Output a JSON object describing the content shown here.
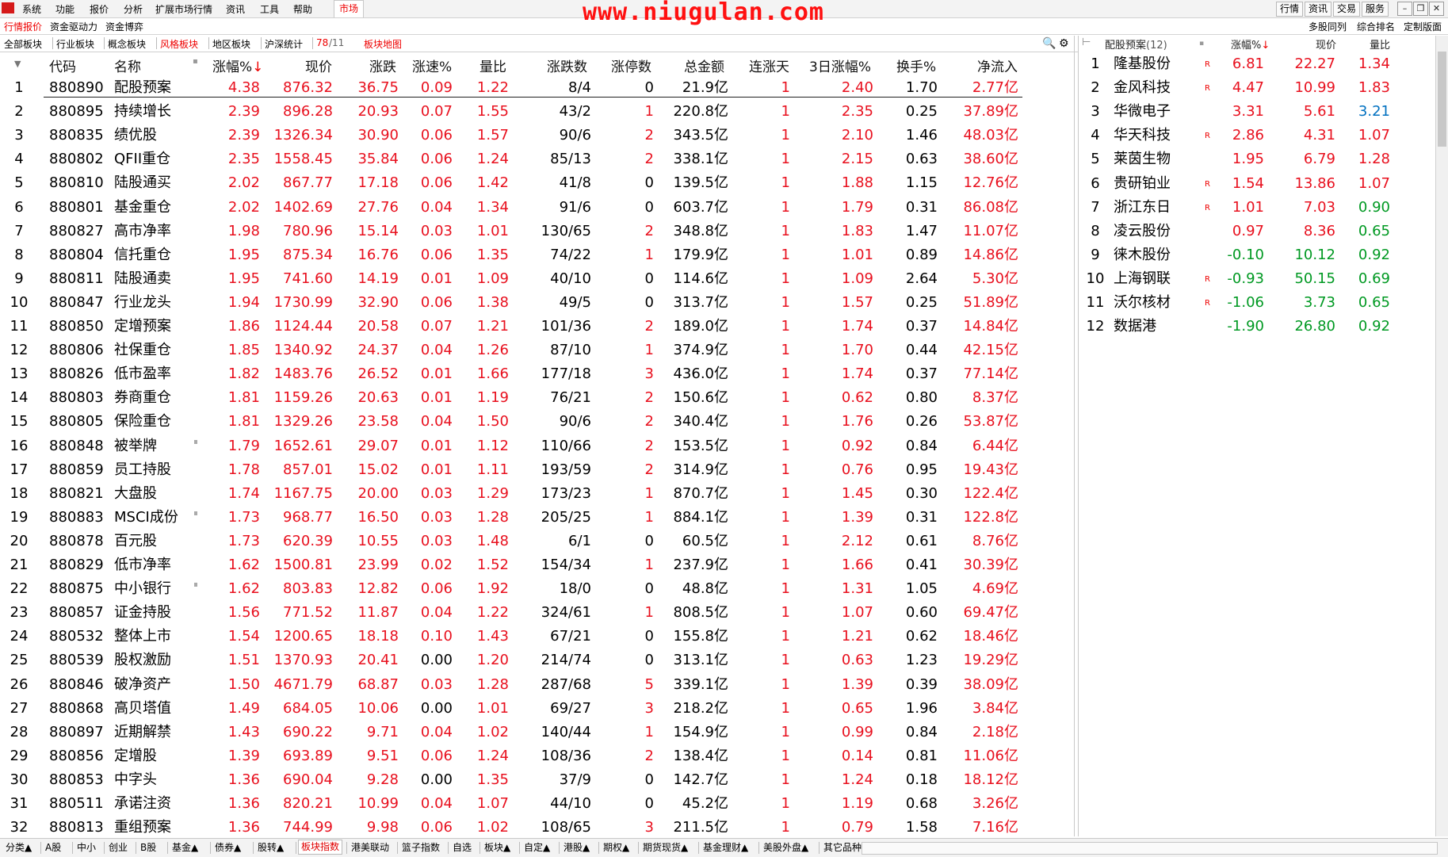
{
  "menubar": {
    "items": [
      "系统",
      "功能",
      "报价",
      "分析",
      "扩展市场行情",
      "资讯",
      "工具",
      "帮助"
    ],
    "market_label": "市场",
    "watermark": "www.niugulan.com",
    "top_right_buttons": [
      "行情",
      "资讯",
      "交易",
      "服务"
    ]
  },
  "row2": {
    "tabs": [
      "行情报价",
      "资金驱动力",
      "资金博弈"
    ],
    "right_tabs": [
      "多股同列",
      "综合排名",
      "定制版面"
    ]
  },
  "row3": {
    "tabs": [
      "全部板块",
      "行业板块",
      "概念板块",
      "风格板块",
      "地区板块",
      "沪深统计"
    ],
    "active_tab": "风格板块",
    "page_current": "78",
    "page_total": "/11",
    "map_label": "板块地图"
  },
  "main_table": {
    "headers": [
      "代码",
      "名称",
      "涨幅%",
      "现价",
      "涨跌",
      "涨速%",
      "量比",
      "涨跌数",
      "涨停数",
      "总金额",
      "连涨天",
      "3日涨幅%",
      "换手%",
      "净流入"
    ],
    "sort_arrow": "↓",
    "rows": [
      [
        "1",
        "880890",
        "配股预案",
        "4.38",
        "876.32",
        "36.75",
        "0.09",
        "1.22",
        "8/4",
        "0",
        "21.9亿",
        "1",
        "2.40",
        "1.70",
        "2.77亿"
      ],
      [
        "2",
        "880895",
        "持续增长",
        "2.39",
        "896.28",
        "20.93",
        "0.07",
        "1.55",
        "43/2",
        "1",
        "220.8亿",
        "1",
        "2.35",
        "0.25",
        "37.89亿"
      ],
      [
        "3",
        "880835",
        "绩优股",
        "2.39",
        "1326.34",
        "30.90",
        "0.06",
        "1.57",
        "90/6",
        "2",
        "343.5亿",
        "1",
        "2.10",
        "1.46",
        "48.03亿"
      ],
      [
        "4",
        "880802",
        "QFII重仓",
        "2.35",
        "1558.45",
        "35.84",
        "0.06",
        "1.24",
        "85/13",
        "2",
        "338.1亿",
        "1",
        "2.15",
        "0.63",
        "38.60亿"
      ],
      [
        "5",
        "880810",
        "陆股通买",
        "2.02",
        "867.77",
        "17.18",
        "0.06",
        "1.42",
        "41/8",
        "0",
        "139.5亿",
        "1",
        "1.88",
        "1.15",
        "12.76亿"
      ],
      [
        "6",
        "880801",
        "基金重仓",
        "2.02",
        "1402.69",
        "27.76",
        "0.04",
        "1.34",
        "91/6",
        "0",
        "603.7亿",
        "1",
        "1.79",
        "0.31",
        "86.08亿"
      ],
      [
        "7",
        "880827",
        "高市净率",
        "1.98",
        "780.96",
        "15.14",
        "0.03",
        "1.01",
        "130/65",
        "2",
        "348.8亿",
        "1",
        "1.83",
        "1.47",
        "11.07亿"
      ],
      [
        "8",
        "880804",
        "信托重仓",
        "1.95",
        "875.34",
        "16.76",
        "0.06",
        "1.35",
        "74/22",
        "1",
        "179.9亿",
        "1",
        "1.01",
        "0.89",
        "14.86亿"
      ],
      [
        "9",
        "880811",
        "陆股通卖",
        "1.95",
        "741.60",
        "14.19",
        "0.01",
        "1.09",
        "40/10",
        "0",
        "114.6亿",
        "1",
        "1.09",
        "2.64",
        "5.30亿"
      ],
      [
        "10",
        "880847",
        "行业龙头",
        "1.94",
        "1730.99",
        "32.90",
        "0.06",
        "1.38",
        "49/5",
        "0",
        "313.7亿",
        "1",
        "1.57",
        "0.25",
        "51.89亿"
      ],
      [
        "11",
        "880850",
        "定增预案",
        "1.86",
        "1124.44",
        "20.58",
        "0.07",
        "1.21",
        "101/36",
        "2",
        "189.0亿",
        "1",
        "1.74",
        "0.37",
        "14.84亿"
      ],
      [
        "12",
        "880806",
        "社保重仓",
        "1.85",
        "1340.92",
        "24.37",
        "0.04",
        "1.26",
        "87/10",
        "1",
        "374.9亿",
        "1",
        "1.70",
        "0.44",
        "42.15亿"
      ],
      [
        "13",
        "880826",
        "低市盈率",
        "1.82",
        "1483.76",
        "26.52",
        "0.01",
        "1.66",
        "177/18",
        "3",
        "436.0亿",
        "1",
        "1.74",
        "0.37",
        "77.14亿"
      ],
      [
        "14",
        "880803",
        "券商重仓",
        "1.81",
        "1159.26",
        "20.63",
        "0.01",
        "1.19",
        "76/21",
        "2",
        "150.6亿",
        "1",
        "0.62",
        "0.80",
        "8.37亿"
      ],
      [
        "15",
        "880805",
        "保险重仓",
        "1.81",
        "1329.26",
        "23.58",
        "0.04",
        "1.50",
        "90/6",
        "2",
        "340.4亿",
        "1",
        "1.76",
        "0.26",
        "53.87亿"
      ],
      [
        "16",
        "880848",
        "被举牌",
        "1.79",
        "1652.61",
        "29.07",
        "0.01",
        "1.12",
        "110/66",
        "2",
        "153.5亿",
        "1",
        "0.92",
        "0.84",
        "6.44亿"
      ],
      [
        "17",
        "880859",
        "员工持股",
        "1.78",
        "857.01",
        "15.02",
        "0.01",
        "1.11",
        "193/59",
        "2",
        "314.9亿",
        "1",
        "0.76",
        "0.95",
        "19.43亿"
      ],
      [
        "18",
        "880821",
        "大盘股",
        "1.74",
        "1167.75",
        "20.00",
        "0.03",
        "1.29",
        "173/23",
        "1",
        "870.7亿",
        "1",
        "1.45",
        "0.30",
        "122.4亿"
      ],
      [
        "19",
        "880883",
        "MSCI成份",
        "1.73",
        "968.77",
        "16.50",
        "0.03",
        "1.28",
        "205/25",
        "1",
        "884.1亿",
        "1",
        "1.39",
        "0.31",
        "122.8亿"
      ],
      [
        "20",
        "880878",
        "百元股",
        "1.73",
        "620.39",
        "10.55",
        "0.03",
        "1.48",
        "6/1",
        "0",
        "60.5亿",
        "1",
        "2.12",
        "0.61",
        "8.76亿"
      ],
      [
        "21",
        "880829",
        "低市净率",
        "1.62",
        "1500.81",
        "23.99",
        "0.02",
        "1.52",
        "154/34",
        "1",
        "237.9亿",
        "1",
        "1.66",
        "0.41",
        "30.39亿"
      ],
      [
        "22",
        "880875",
        "中小银行",
        "1.62",
        "803.83",
        "12.82",
        "0.06",
        "1.92",
        "18/0",
        "0",
        "48.8亿",
        "1",
        "1.31",
        "1.05",
        "4.69亿"
      ],
      [
        "23",
        "880857",
        "证金持股",
        "1.56",
        "771.52",
        "11.87",
        "0.04",
        "1.22",
        "324/61",
        "1",
        "808.5亿",
        "1",
        "1.07",
        "0.60",
        "69.47亿"
      ],
      [
        "24",
        "880532",
        "整体上市",
        "1.54",
        "1200.65",
        "18.18",
        "0.10",
        "1.43",
        "67/21",
        "0",
        "155.8亿",
        "1",
        "1.21",
        "0.62",
        "18.46亿"
      ],
      [
        "25",
        "880539",
        "股权激励",
        "1.51",
        "1370.93",
        "20.41",
        "0.00",
        "1.20",
        "214/74",
        "0",
        "313.1亿",
        "1",
        "0.63",
        "1.23",
        "19.29亿"
      ],
      [
        "26",
        "880846",
        "破净资产",
        "1.50",
        "4671.79",
        "68.87",
        "0.03",
        "1.28",
        "287/68",
        "5",
        "339.1亿",
        "1",
        "1.39",
        "0.39",
        "38.09亿"
      ],
      [
        "27",
        "880868",
        "高贝塔值",
        "1.49",
        "684.05",
        "10.06",
        "0.00",
        "1.01",
        "69/27",
        "3",
        "218.2亿",
        "1",
        "0.65",
        "1.96",
        "3.84亿"
      ],
      [
        "28",
        "880897",
        "近期解禁",
        "1.43",
        "690.22",
        "9.71",
        "0.04",
        "1.02",
        "140/44",
        "1",
        "154.9亿",
        "1",
        "0.99",
        "0.84",
        "2.18亿"
      ],
      [
        "29",
        "880856",
        "定增股",
        "1.39",
        "693.89",
        "9.51",
        "0.06",
        "1.24",
        "108/36",
        "2",
        "138.4亿",
        "1",
        "0.14",
        "0.81",
        "11.06亿"
      ],
      [
        "30",
        "880853",
        "中字头",
        "1.36",
        "690.04",
        "9.28",
        "0.00",
        "1.35",
        "37/9",
        "0",
        "142.7亿",
        "1",
        "1.24",
        "0.18",
        "18.12亿"
      ],
      [
        "31",
        "880511",
        "承诺注资",
        "1.36",
        "820.21",
        "10.99",
        "0.04",
        "1.07",
        "44/10",
        "0",
        "45.2亿",
        "1",
        "1.19",
        "0.68",
        "3.26亿"
      ],
      [
        "32",
        "880813",
        "重组预案",
        "1.36",
        "744.99",
        "9.98",
        "0.06",
        "1.02",
        "108/65",
        "3",
        "211.5亿",
        "1",
        "0.79",
        "1.58",
        "7.16亿"
      ]
    ]
  },
  "right_panel": {
    "title": "配股预案",
    "count": "(12)",
    "headers": [
      "涨幅%",
      "现价",
      "量比"
    ],
    "sort_arrow": "↓",
    "rows": [
      [
        "1",
        "隆基股份",
        "R",
        "6.81",
        "22.27",
        "1.34"
      ],
      [
        "2",
        "金风科技",
        "R",
        "4.47",
        "10.99",
        "1.83"
      ],
      [
        "3",
        "华微电子",
        "",
        "3.31",
        "5.61",
        "3.21"
      ],
      [
        "4",
        "华天科技",
        "R",
        "2.86",
        "4.31",
        "1.07"
      ],
      [
        "5",
        "莱茵生物",
        "",
        "1.95",
        "6.79",
        "1.28"
      ],
      [
        "6",
        "贵研铂业",
        "R",
        "1.54",
        "13.86",
        "1.07"
      ],
      [
        "7",
        "浙江东日",
        "R",
        "1.01",
        "7.03",
        "0.90"
      ],
      [
        "8",
        "凌云股份",
        "",
        "0.97",
        "8.36",
        "0.65"
      ],
      [
        "9",
        "徕木股份",
        "",
        "-0.10",
        "10.12",
        "0.92"
      ],
      [
        "10",
        "上海钢联",
        "R",
        "-0.93",
        "50.15",
        "0.69"
      ],
      [
        "11",
        "沃尔核材",
        "R",
        "-1.06",
        "3.73",
        "0.65"
      ],
      [
        "12",
        "数据港",
        "",
        "-1.90",
        "26.80",
        "0.92"
      ]
    ]
  },
  "bottom_tabs": [
    "分类▲",
    "A股",
    "中小",
    "创业",
    "B股",
    "基金▲",
    "债券▲",
    "股转▲",
    "板块指数",
    "港美联动",
    "篮子指数",
    "自选",
    "板块▲",
    "自定▲",
    "港股▲",
    "期权▲",
    "期货现货▲",
    "基金理财▲",
    "美股外盘▲",
    "其它品种▲"
  ],
  "bottom_active": "板块指数",
  "colors": {
    "up": "#e8101e",
    "down": "#009922",
    "blue": "#0070c0",
    "accent": "#e00000"
  }
}
